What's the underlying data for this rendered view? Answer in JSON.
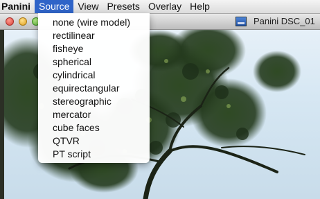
{
  "menubar": {
    "app_name": "Panini",
    "menus": [
      "Source",
      "View",
      "Presets",
      "Overlay",
      "Help"
    ],
    "active_menu": "Source"
  },
  "window": {
    "title": "Panini  DSC_01"
  },
  "source_menu": {
    "items": [
      "none (wire model)",
      "rectilinear",
      "fisheye",
      "spherical",
      "cylindrical",
      "equirectangular",
      "stereographic",
      "mercator",
      "cube faces",
      "QTVR",
      "PT script"
    ]
  },
  "colors": {
    "menu_highlight": "#2f64c8",
    "sky": "#d6e7f3",
    "foliage": "#24381e"
  }
}
